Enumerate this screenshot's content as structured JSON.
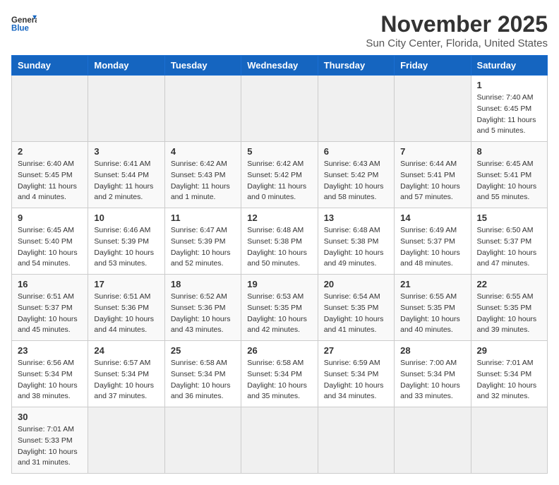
{
  "header": {
    "logo_general": "General",
    "logo_blue": "Blue",
    "month_year": "November 2025",
    "location": "Sun City Center, Florida, United States"
  },
  "weekdays": [
    "Sunday",
    "Monday",
    "Tuesday",
    "Wednesday",
    "Thursday",
    "Friday",
    "Saturday"
  ],
  "weeks": [
    [
      {
        "day": "",
        "info": ""
      },
      {
        "day": "",
        "info": ""
      },
      {
        "day": "",
        "info": ""
      },
      {
        "day": "",
        "info": ""
      },
      {
        "day": "",
        "info": ""
      },
      {
        "day": "",
        "info": ""
      },
      {
        "day": "1",
        "info": "Sunrise: 7:40 AM\nSunset: 6:45 PM\nDaylight: 11 hours\nand 5 minutes."
      }
    ],
    [
      {
        "day": "2",
        "info": "Sunrise: 6:40 AM\nSunset: 5:45 PM\nDaylight: 11 hours\nand 4 minutes."
      },
      {
        "day": "3",
        "info": "Sunrise: 6:41 AM\nSunset: 5:44 PM\nDaylight: 11 hours\nand 2 minutes."
      },
      {
        "day": "4",
        "info": "Sunrise: 6:42 AM\nSunset: 5:43 PM\nDaylight: 11 hours\nand 1 minute."
      },
      {
        "day": "5",
        "info": "Sunrise: 6:42 AM\nSunset: 5:42 PM\nDaylight: 11 hours\nand 0 minutes."
      },
      {
        "day": "6",
        "info": "Sunrise: 6:43 AM\nSunset: 5:42 PM\nDaylight: 10 hours\nand 58 minutes."
      },
      {
        "day": "7",
        "info": "Sunrise: 6:44 AM\nSunset: 5:41 PM\nDaylight: 10 hours\nand 57 minutes."
      },
      {
        "day": "8",
        "info": "Sunrise: 6:45 AM\nSunset: 5:41 PM\nDaylight: 10 hours\nand 55 minutes."
      }
    ],
    [
      {
        "day": "9",
        "info": "Sunrise: 6:45 AM\nSunset: 5:40 PM\nDaylight: 10 hours\nand 54 minutes."
      },
      {
        "day": "10",
        "info": "Sunrise: 6:46 AM\nSunset: 5:39 PM\nDaylight: 10 hours\nand 53 minutes."
      },
      {
        "day": "11",
        "info": "Sunrise: 6:47 AM\nSunset: 5:39 PM\nDaylight: 10 hours\nand 52 minutes."
      },
      {
        "day": "12",
        "info": "Sunrise: 6:48 AM\nSunset: 5:38 PM\nDaylight: 10 hours\nand 50 minutes."
      },
      {
        "day": "13",
        "info": "Sunrise: 6:48 AM\nSunset: 5:38 PM\nDaylight: 10 hours\nand 49 minutes."
      },
      {
        "day": "14",
        "info": "Sunrise: 6:49 AM\nSunset: 5:37 PM\nDaylight: 10 hours\nand 48 minutes."
      },
      {
        "day": "15",
        "info": "Sunrise: 6:50 AM\nSunset: 5:37 PM\nDaylight: 10 hours\nand 47 minutes."
      }
    ],
    [
      {
        "day": "16",
        "info": "Sunrise: 6:51 AM\nSunset: 5:37 PM\nDaylight: 10 hours\nand 45 minutes."
      },
      {
        "day": "17",
        "info": "Sunrise: 6:51 AM\nSunset: 5:36 PM\nDaylight: 10 hours\nand 44 minutes."
      },
      {
        "day": "18",
        "info": "Sunrise: 6:52 AM\nSunset: 5:36 PM\nDaylight: 10 hours\nand 43 minutes."
      },
      {
        "day": "19",
        "info": "Sunrise: 6:53 AM\nSunset: 5:35 PM\nDaylight: 10 hours\nand 42 minutes."
      },
      {
        "day": "20",
        "info": "Sunrise: 6:54 AM\nSunset: 5:35 PM\nDaylight: 10 hours\nand 41 minutes."
      },
      {
        "day": "21",
        "info": "Sunrise: 6:55 AM\nSunset: 5:35 PM\nDaylight: 10 hours\nand 40 minutes."
      },
      {
        "day": "22",
        "info": "Sunrise: 6:55 AM\nSunset: 5:35 PM\nDaylight: 10 hours\nand 39 minutes."
      }
    ],
    [
      {
        "day": "23",
        "info": "Sunrise: 6:56 AM\nSunset: 5:34 PM\nDaylight: 10 hours\nand 38 minutes."
      },
      {
        "day": "24",
        "info": "Sunrise: 6:57 AM\nSunset: 5:34 PM\nDaylight: 10 hours\nand 37 minutes."
      },
      {
        "day": "25",
        "info": "Sunrise: 6:58 AM\nSunset: 5:34 PM\nDaylight: 10 hours\nand 36 minutes."
      },
      {
        "day": "26",
        "info": "Sunrise: 6:58 AM\nSunset: 5:34 PM\nDaylight: 10 hours\nand 35 minutes."
      },
      {
        "day": "27",
        "info": "Sunrise: 6:59 AM\nSunset: 5:34 PM\nDaylight: 10 hours\nand 34 minutes."
      },
      {
        "day": "28",
        "info": "Sunrise: 7:00 AM\nSunset: 5:34 PM\nDaylight: 10 hours\nand 33 minutes."
      },
      {
        "day": "29",
        "info": "Sunrise: 7:01 AM\nSunset: 5:34 PM\nDaylight: 10 hours\nand 32 minutes."
      }
    ],
    [
      {
        "day": "30",
        "info": "Sunrise: 7:01 AM\nSunset: 5:33 PM\nDaylight: 10 hours\nand 31 minutes."
      },
      {
        "day": "",
        "info": ""
      },
      {
        "day": "",
        "info": ""
      },
      {
        "day": "",
        "info": ""
      },
      {
        "day": "",
        "info": ""
      },
      {
        "day": "",
        "info": ""
      },
      {
        "day": "",
        "info": ""
      }
    ]
  ]
}
